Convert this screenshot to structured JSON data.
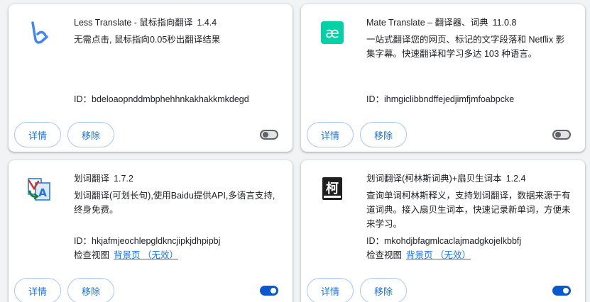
{
  "extensions": [
    {
      "name": "Less Translate - 鼠标指向翻译",
      "version": "1.4.4",
      "description": "无需点击, 鼠标指向0.05秒出翻译结果",
      "id_label": "ID：",
      "id": "bdeloaopnddmbphehhnkakhakkmkdegd",
      "detail_label": "详情",
      "remove_label": "移除",
      "enabled": false
    },
    {
      "name": "Mate Translate – 翻译器、词典",
      "version": "11.0.8",
      "description": "一站式翻译您的网页、标记的文字段落和 Netflix 影集字幕。快速翻译和学习多达 103 种语言。",
      "id_label": "ID：",
      "id": "ihmgiclibbndffejedjimfjmfoabpcke",
      "detail_label": "详情",
      "remove_label": "移除",
      "enabled": false
    },
    {
      "name": "划词翻译",
      "version": "1.7.2",
      "description": "划词翻译(可划长句),使用Baidu提供API,多语言支持,终身免费。",
      "id_label": "ID：",
      "id": "hkjafmjeochlepgldkncjipkjdhpipbj",
      "inspect_label": "检查视图",
      "inspect_link": "背景页 （无效）",
      "detail_label": "详情",
      "remove_label": "移除",
      "enabled": true
    },
    {
      "name": "划词翻译(柯林斯词典)+扇贝生词本",
      "version": "1.2.4",
      "description": "查询单词柯林斯释义，支持划词翻译，数据来源于有道词典。接入扇贝生词本，快速记录新单词，方便未来学习。",
      "id_label": "ID：",
      "id": "mkohdjbfagmlcaclajmadgkojelkbbfj",
      "inspect_label": "检查视图",
      "inspect_link": "背景页 （无效）",
      "detail_label": "详情",
      "remove_label": "移除",
      "enabled": true,
      "icon_char": "柯"
    }
  ],
  "colors": {
    "accent": "#1a73e8",
    "toggle_on": "#0b57d0",
    "mate_icon": "#00d1a7"
  },
  "icons": [
    "less-translate-logo",
    "mate-translate-logo",
    "huaci-translate-logo",
    "collins-dict-logo"
  ]
}
